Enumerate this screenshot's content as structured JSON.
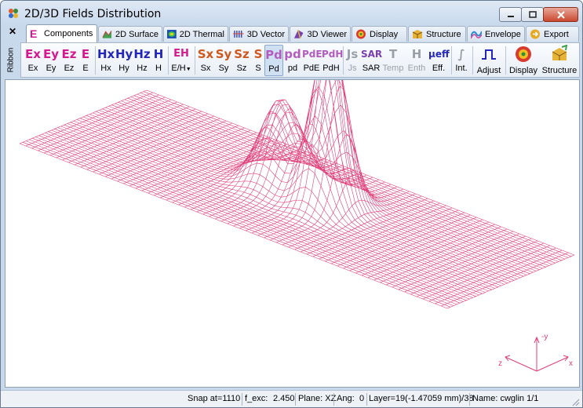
{
  "window": {
    "title": "2D/3D Fields Distribution",
    "controls": [
      "minimize",
      "maximize",
      "close"
    ]
  },
  "ribbon": {
    "close_label": "✕",
    "side_label": "Ribbon",
    "tabs": [
      {
        "label": "Components",
        "icon": "E-letter-icon",
        "active": true
      },
      {
        "label": "2D Surface",
        "icon": "surface-2d-icon"
      },
      {
        "label": "2D Thermal",
        "icon": "thermal-2d-icon"
      },
      {
        "label": "3D Vector",
        "icon": "vector-3d-icon"
      },
      {
        "label": "3D Viewer",
        "icon": "viewer-3d-icon"
      },
      {
        "label": "Display",
        "icon": "display-icon"
      },
      {
        "label": "Structure",
        "icon": "structure-icon"
      },
      {
        "label": "Envelope",
        "icon": "envelope-icon"
      },
      {
        "label": "Export",
        "icon": "export-icon"
      }
    ]
  },
  "toolbar": {
    "buttons": [
      {
        "glyph": "Ex",
        "label": "Ex"
      },
      {
        "glyph": "Ey",
        "label": "Ey"
      },
      {
        "glyph": "Ez",
        "label": "Ez"
      },
      {
        "glyph": "E",
        "label": "E"
      },
      {
        "glyph": "Hx",
        "label": "Hx"
      },
      {
        "glyph": "Hy",
        "label": "Hy"
      },
      {
        "glyph": "Hz",
        "label": "Hz"
      },
      {
        "glyph": "H",
        "label": "H"
      },
      {
        "glyph": "EH",
        "label": "E/H"
      },
      {
        "glyph": "Sx",
        "label": "Sx"
      },
      {
        "glyph": "Sy",
        "label": "Sy"
      },
      {
        "glyph": "Sz",
        "label": "Sz"
      },
      {
        "glyph": "S",
        "label": "S"
      },
      {
        "glyph": "Pd",
        "label": "Pd",
        "selected": true
      },
      {
        "glyph": "pd",
        "label": "pd"
      },
      {
        "glyph": "PdE",
        "label": "PdE"
      },
      {
        "glyph": "PdH",
        "label": "PdH"
      },
      {
        "glyph": "Js",
        "label": "Js"
      },
      {
        "glyph": "SAR",
        "label": "SAR"
      },
      {
        "glyph": "T",
        "label": "Temp"
      },
      {
        "glyph": "H",
        "label": "Enth"
      },
      {
        "glyph": "μeff",
        "label": "Eff."
      },
      {
        "glyph": "∫",
        "label": "Int."
      },
      {
        "glyph": "⎍",
        "label": "Adjust"
      },
      {
        "glyph": "",
        "label": "Display"
      },
      {
        "glyph": "",
        "label": "Structure"
      }
    ]
  },
  "axes": {
    "x": "x",
    "y": "-y",
    "z": "z"
  },
  "status": {
    "snap": "Snap at=1110",
    "fexc_label": "f_exc:",
    "fexc_value": "2.450",
    "plane": "Plane: XZ",
    "ang_label": "Ang:",
    "ang_value": "0",
    "layer": "Layer=19(-1.47059 mm)/38",
    "name": "Name: cwglin 1/1"
  },
  "colors": {
    "mesh": "#e0407a",
    "accent": "#d6188f"
  }
}
